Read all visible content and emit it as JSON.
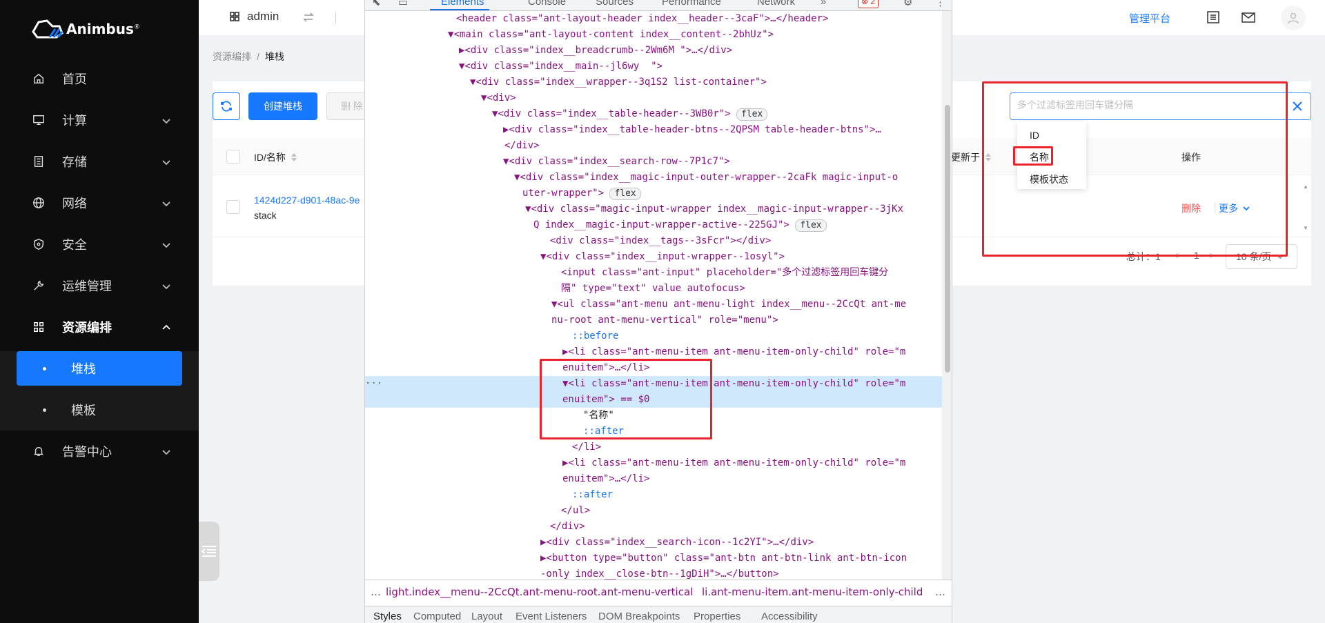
{
  "brand": {
    "name": "Animbus",
    "reg": "®",
    "accent": "#1677ff"
  },
  "sidebar": {
    "items": [
      {
        "label": "首页",
        "icon": "home-icon",
        "expandable": false
      },
      {
        "label": "计算",
        "icon": "monitor-icon",
        "expandable": true
      },
      {
        "label": "存储",
        "icon": "storage-icon",
        "expandable": true
      },
      {
        "label": "网络",
        "icon": "globe-icon",
        "expandable": true
      },
      {
        "label": "安全",
        "icon": "shield-icon",
        "expandable": true
      },
      {
        "label": "运维管理",
        "icon": "wrench-icon",
        "expandable": true
      },
      {
        "label": "资源编排",
        "icon": "grid-icon",
        "expandable": true,
        "open": true
      },
      {
        "label": "告警中心",
        "icon": "bell-icon",
        "expandable": true
      }
    ],
    "sub_items": [
      {
        "label": "堆栈",
        "active": true
      },
      {
        "label": "模板",
        "active": false
      }
    ]
  },
  "topbar": {
    "project": "admin",
    "mgmt_link": "管理平台"
  },
  "breadcrumb": {
    "parent": "资源编排",
    "separator": "/",
    "current": "堆栈"
  },
  "toolbar": {
    "create_label": "创建堆栈",
    "delete_label": "删 除"
  },
  "table": {
    "col_id_name": "ID/名称",
    "col_updated": "更新于",
    "col_actions": "操作",
    "row": {
      "id": "1424d227-d901-48ac-9e",
      "name": "stack",
      "delete": "删除",
      "more": "更多"
    }
  },
  "pager": {
    "total": "总计：1",
    "page": "1",
    "page_size": "10 条/页"
  },
  "search": {
    "placeholder": "多个过滤标签用回车键分隔",
    "options": [
      "ID",
      "名称",
      "模板状态"
    ]
  },
  "devtools": {
    "tabs": [
      "Elements",
      "Console",
      "Sources",
      "Performance",
      "Network",
      "»"
    ],
    "error_count": "2",
    "breadcrumb_left": "light.index__menu--2CcQt.ant-menu-root.ant-menu-vertical",
    "breadcrumb_right": "li.ant-menu-item.ant-menu-item-only-child",
    "bottom_tabs": [
      "Styles",
      "Computed",
      "Layout",
      "Event Listeners",
      "DOM Breakpoints",
      "Properties",
      "Accessibility"
    ],
    "lines": [
      "<header class=\"ant-layout-header index__header--3caF\">…</header>",
      "<main class=\"ant-layout-content index__content--2bhUz\">",
      "<div class=\"index__breadcrumb--2Wm6M \">…</div>",
      "<div class=\"index__main--jl6wy  \">",
      "<div class=\"index__wrapper--3q1S2 list-container\">",
      "<div>",
      "<div class=\"index__table-header--3WB0r\">",
      "<div class=\"index__table-header-btns--2QPSM table-header-btns\">…",
      "</div>",
      "<div class=\"index__search-row--7P1c7\">",
      "<div class=\"index__magic-input-outer-wrapper--2caFk magic-input-o",
      "uter-wrapper\">",
      "<div class=\"magic-input-wrapper index__magic-input-wrapper--3jKx",
      "Q index__magic-input-wrapper-active--225GJ\">",
      "<div class=\"index__tags--3sFcr\"></div>",
      "<div class=\"index__input-wrapper--1osyl\">",
      "<input class=\"ant-input\" placeholder=\"多个过滤标签用回车键分",
      "隔\" type=\"text\" value autofocus>",
      "<ul class=\"ant-menu ant-menu-light index__menu--2CcQt ant-me",
      "nu-root ant-menu-vertical\" role=\"menu\">",
      "::before",
      "<li class=\"ant-menu-item ant-menu-item-only-child\" role=\"m",
      "enuitem\">…</li>",
      "<li class=\"ant-menu-item ant-menu-item-only-child\" role=\"m",
      "enuitem\"> == $0",
      "\"名称\"",
      "::after",
      "</li>",
      "<li class=\"ant-menu-item ant-menu-item-only-child\" role=\"m",
      "enuitem\">…</li>",
      "::after",
      "</ul>",
      "</div>",
      "<div class=\"index__search-icon--1c2YI\">…</div>",
      "<button type=\"button\" class=\"ant-btn ant-btn-link ant-btn-icon",
      "-only index__close-btn--1gDiH\">…</button>"
    ]
  }
}
